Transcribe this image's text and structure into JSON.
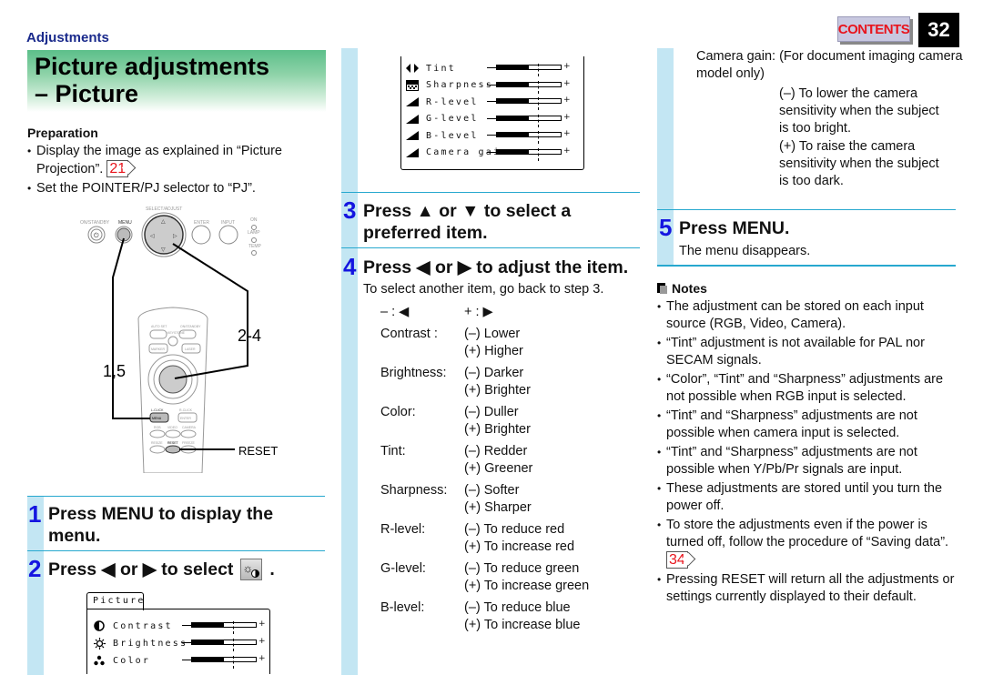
{
  "header": {
    "section": "Adjustments",
    "contents_label": "CONTENTS",
    "page_number": "32",
    "accent_blue": "#1515e0",
    "ref_red": "#e8141c"
  },
  "title": {
    "line1": "Picture adjustments",
    "line2": "– Picture"
  },
  "preparation": {
    "heading": "Preparation",
    "items": [
      {
        "text": "Display the image as explained in “Picture Projection”.",
        "ref": "21"
      },
      {
        "text": "Set the POINTER/PJ selector to “PJ”."
      }
    ]
  },
  "diagram": {
    "panel_labels": {
      "select_adjust": "SELECT/ADJUST",
      "on_standby": "ON/STANDBY",
      "menu": "MENU",
      "enter": "ENTER",
      "input": "INPUT",
      "on": "ON",
      "lamp": "LAMP",
      "temp": "TEMP"
    },
    "remote_labels": {
      "auto_set": "AUTO SET",
      "keystone": "KEYSTONE",
      "on_standby": "ON/STANDBY",
      "marker": "MARKER",
      "laser": "LASER",
      "l_click": "L-CLICK",
      "r_click": "R-CLICK",
      "menu": "MENU",
      "enter": "ENTER",
      "rgb": "RGB",
      "video": "VIDEO",
      "camera": "CAMERA",
      "resize": "RESIZE",
      "reset": "RESET",
      "freeze": "FREEZE"
    },
    "callouts": {
      "steps_2_4": "2-4",
      "steps_1_5": "1,5",
      "reset": "RESET"
    }
  },
  "steps": [
    {
      "num": "1",
      "text": "Press MENU to display the menu."
    },
    {
      "num": "2",
      "text_before": "Press ◀ or ▶ to select",
      "text_after": "."
    },
    {
      "num": "3",
      "text": "Press ▲ or ▼ to select a preferred item."
    },
    {
      "num": "4",
      "text": "Press ◀ or ▶ to adjust the item.",
      "sub": "To select another item, go back to step 3."
    },
    {
      "num": "5",
      "text": "Press MENU.",
      "sub": "The menu disappears."
    }
  ],
  "osd_menu": {
    "tab": "Picture",
    "items": [
      {
        "icon": "contrast-icon",
        "label": "Contrast",
        "level": 0.5
      },
      {
        "icon": "brightness-icon",
        "label": "Brightness",
        "level": 0.5
      },
      {
        "icon": "color-icon",
        "label": "Color",
        "level": 0.5
      },
      {
        "icon": "tint-icon",
        "label": "Tint",
        "level": 0.5
      },
      {
        "icon": "sharpness-icon",
        "label": "Sharpness",
        "level": 0.5
      },
      {
        "icon": "level-icon",
        "label": "R-level",
        "level": 0.5
      },
      {
        "icon": "level-icon",
        "label": "G-level",
        "level": 0.5
      },
      {
        "icon": "level-icon",
        "label": "B-level",
        "level": 0.5
      },
      {
        "icon": "level-icon",
        "label": "Camera gain",
        "level": 0.5
      }
    ],
    "plus": "+"
  },
  "adjust_table": {
    "minus_key": "– : ◀",
    "plus_key": "+ : ▶",
    "rows": [
      {
        "key": "Contrast :",
        "minus": "(–) Lower",
        "plus": "(+) Higher"
      },
      {
        "key": "Brightness:",
        "minus": "(–) Darker",
        "plus": "(+) Brighter"
      },
      {
        "key": "Color:",
        "minus": "(–) Duller",
        "plus": "(+) Brighter"
      },
      {
        "key": "Tint:",
        "minus": "(–) Redder",
        "plus": "(+) Greener"
      },
      {
        "key": "Sharpness:",
        "minus": "(–) Softer",
        "plus": "(+) Sharper"
      },
      {
        "key": "R-level:",
        "minus": "(–) To reduce red",
        "plus": "(+) To increase red"
      },
      {
        "key": "G-level:",
        "minus": "(–) To reduce green",
        "plus": "(+) To increase green"
      },
      {
        "key": "B-level:",
        "minus": "(–) To reduce blue",
        "plus": "(+) To increase blue"
      }
    ],
    "camera_gain": {
      "intro": "Camera gain: (For document imaging camera model only)",
      "minus": "(–) To lower the camera sensitivity when the subject is too bright.",
      "plus": "(+) To raise the camera sensitivity when the subject is too dark."
    }
  },
  "notes": {
    "heading": "Notes",
    "items": [
      {
        "text": "The adjustment can be stored on each input source (RGB, Video, Camera)."
      },
      {
        "text": "“Tint” adjustment is not available for PAL nor SECAM signals."
      },
      {
        "text": "“Color”, “Tint” and “Sharpness” adjustments are not possible when RGB input is selected."
      },
      {
        "text": "“Tint” and “Sharpness” adjustments are not possible when camera input is selected."
      },
      {
        "text": "“Tint” and “Sharpness” adjustments are not possible when Y/Pb/Pr signals are input."
      },
      {
        "text": "These adjustments are stored until you turn the power off."
      },
      {
        "text": "To store the adjustments even if the power is turned off, follow the procedure of “Saving data”.",
        "ref": "34"
      },
      {
        "text": "Pressing RESET will return all the adjustments or settings currently displayed to their default."
      }
    ]
  }
}
